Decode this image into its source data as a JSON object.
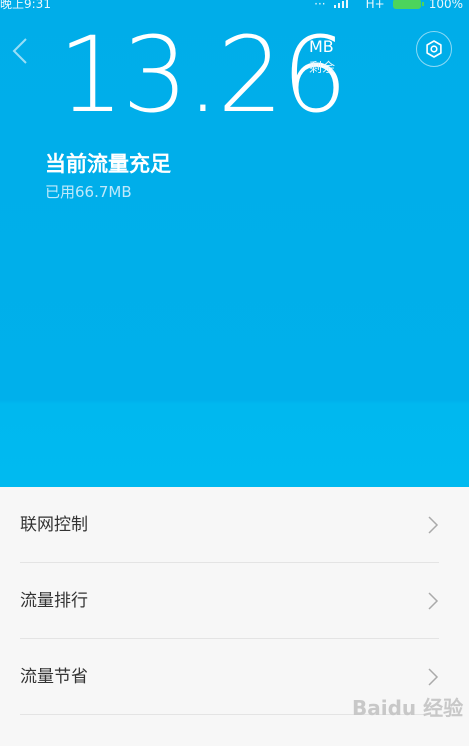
{
  "status_bar": {
    "time": "晚上9:31",
    "network": "H+",
    "battery": "100%"
  },
  "header": {
    "remaining_value": "13.26",
    "unit": "MB",
    "unit_caption": "剩余",
    "status_title": "当前流量充足",
    "used_text": "已用66.7MB"
  },
  "menu": {
    "items": [
      {
        "label": "联网控制"
      },
      {
        "label": "流量排行"
      },
      {
        "label": "流量节省"
      }
    ]
  },
  "watermark": {
    "text": "Baidu 经验"
  },
  "colors": {
    "accent": "#00ade9",
    "list_bg": "#f7f7f7",
    "text_primary": "#333333",
    "chevron": "#aaaaaa"
  }
}
